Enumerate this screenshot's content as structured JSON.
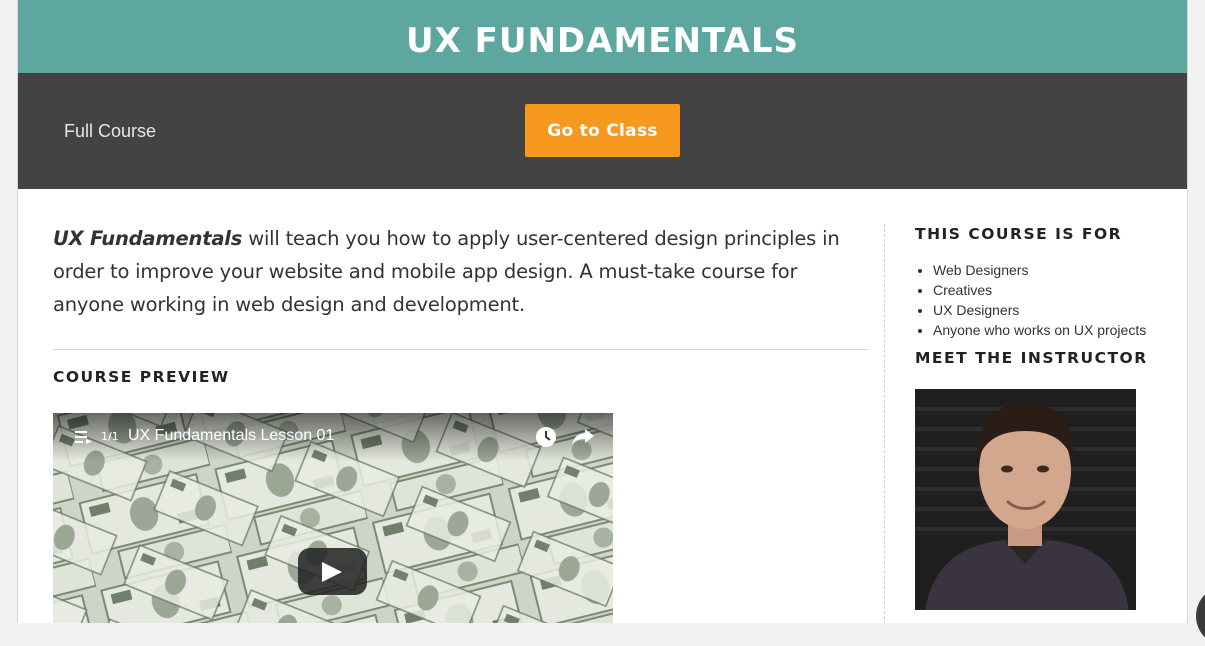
{
  "header": {
    "title": "UX FUNDAMENTALS",
    "full_course_label": "Full Course",
    "cta_label": "Go to Class"
  },
  "intro": {
    "course_name": "UX Fundamentals",
    "description": " will teach you how to apply user-centered design principles in order to improve your website and mobile app design. A must-take course for anyone working in web design and development."
  },
  "preview": {
    "heading": "COURSE PREVIEW",
    "video": {
      "playlist_count": "1/1",
      "title": "UX Fundamentals Lesson 01"
    }
  },
  "sidebar": {
    "audience_heading": "THIS COURSE IS FOR",
    "audience": [
      "Web Designers",
      "Creatives",
      "UX Designers",
      "Anyone who works on UX projects"
    ],
    "instructor_heading": "MEET THE INSTRUCTOR"
  },
  "colors": {
    "title_bar": "#5ea6a0",
    "sub_bar": "#434343",
    "cta": "#f7981f"
  }
}
